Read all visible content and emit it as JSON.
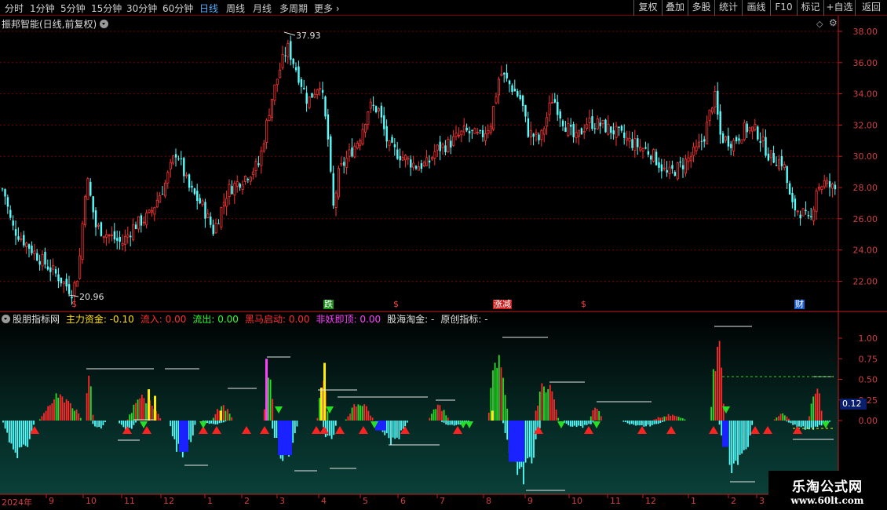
{
  "toolbar": {
    "periods": [
      "分时",
      "1分钟",
      "5分钟",
      "15分钟",
      "30分钟",
      "60分钟",
      "日线",
      "周线",
      "月线",
      "多周期",
      "更多"
    ],
    "active_period": "日线",
    "right_buttons": [
      "复权",
      "叠加",
      "多股",
      "统计",
      "画线",
      "F10",
      "标记",
      "+自选",
      "返回"
    ]
  },
  "main_chart": {
    "title": "振邦智能(日线,前复权)",
    "price_high_label": "37.93",
    "price_low_label": "20.96",
    "y_ticks": [
      "38.00",
      "36.00",
      "34.00",
      "32.00",
      "30.00",
      "28.00",
      "26.00",
      "24.00",
      "22.00"
    ],
    "event_markers": [
      {
        "text": "$",
        "color": "#ff4040"
      },
      {
        "text": "跌",
        "color": "#ffffff",
        "bg": "#1a8f1a"
      },
      {
        "text": "$",
        "color": "#ff4040"
      },
      {
        "text": "涨减",
        "color": "#ffffff",
        "bg": "#cc2020"
      },
      {
        "text": "$",
        "color": "#ff4040"
      },
      {
        "text": "财",
        "color": "#ffffff",
        "bg": "#1a5fd0"
      }
    ]
  },
  "indicator": {
    "name": "股朋指标网",
    "items": [
      {
        "label": "主力资金:",
        "value": "-0.10",
        "color": "#ffe000"
      },
      {
        "label": "流入:",
        "value": "0.00",
        "color": "#ff3030"
      },
      {
        "label": "流出:",
        "value": "0.00",
        "color": "#30ff30"
      },
      {
        "label": "黑马启动:",
        "value": "0.00",
        "color": "#ff3030"
      },
      {
        "label": "非妖即顶:",
        "value": "0.00",
        "color": "#ff40ff"
      },
      {
        "label": "股海淘金:",
        "value": "-",
        "color": "#e0e0e0"
      },
      {
        "label": "原创指标:",
        "value": "-",
        "color": "#e0e0e0"
      }
    ],
    "y_ticks": [
      "1.00",
      "0.75",
      "0.50",
      "0.25",
      "0.00"
    ],
    "current_value": "0.12"
  },
  "date_axis": [
    "2024年",
    "9",
    "10",
    "11",
    "12",
    "1",
    "2",
    "3",
    "4",
    "5",
    "6",
    "7",
    "8",
    "9",
    "10",
    "11",
    "12",
    "1",
    "2",
    "3"
  ],
  "watermark": {
    "line1": "乐淘公式网",
    "line2": "www.60lt.com"
  },
  "colors": {
    "up": "#ff3232",
    "down": "#54ffff",
    "grid": "#8b0000",
    "axis": "#c02020"
  }
}
